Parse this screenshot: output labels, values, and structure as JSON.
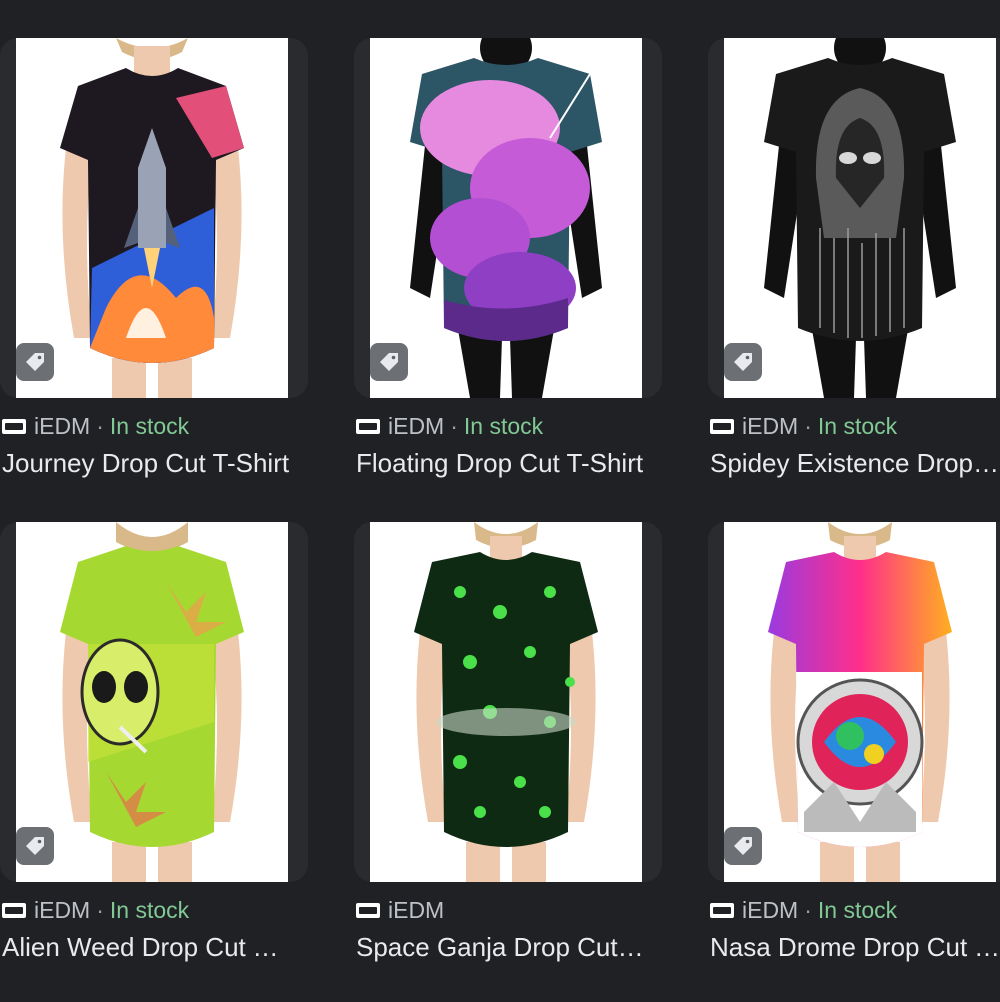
{
  "results": [
    {
      "seller": "iEDM",
      "separator": "·",
      "stock": "In stock",
      "title": "Journey Drop Cut T-Shirt"
    },
    {
      "seller": "iEDM",
      "separator": "·",
      "stock": "In stock",
      "title": "Floating Drop Cut T-Shirt"
    },
    {
      "seller": "iEDM",
      "separator": "·",
      "stock": "In stock",
      "title": "Spidey Existence Drop Cut T-Shirt"
    },
    {
      "seller": "iEDM",
      "separator": "·",
      "stock": "In stock",
      "title": "Alien Weed Drop Cut T-Shirt"
    },
    {
      "seller": "iEDM",
      "separator": "",
      "stock": "",
      "title": "Space Ganja Drop Cut T-Shirt"
    },
    {
      "seller": "iEDM",
      "separator": "·",
      "stock": "In stock",
      "title": "Nasa Drome Drop Cut T-Shirt"
    }
  ],
  "icons": {
    "tag": "tag-icon",
    "favicon": "iedm-logo-icon"
  },
  "colors": {
    "background": "#202124",
    "in_stock": "#81c995",
    "title_text": "#e8eaed",
    "seller_text": "#bdc1c6"
  }
}
